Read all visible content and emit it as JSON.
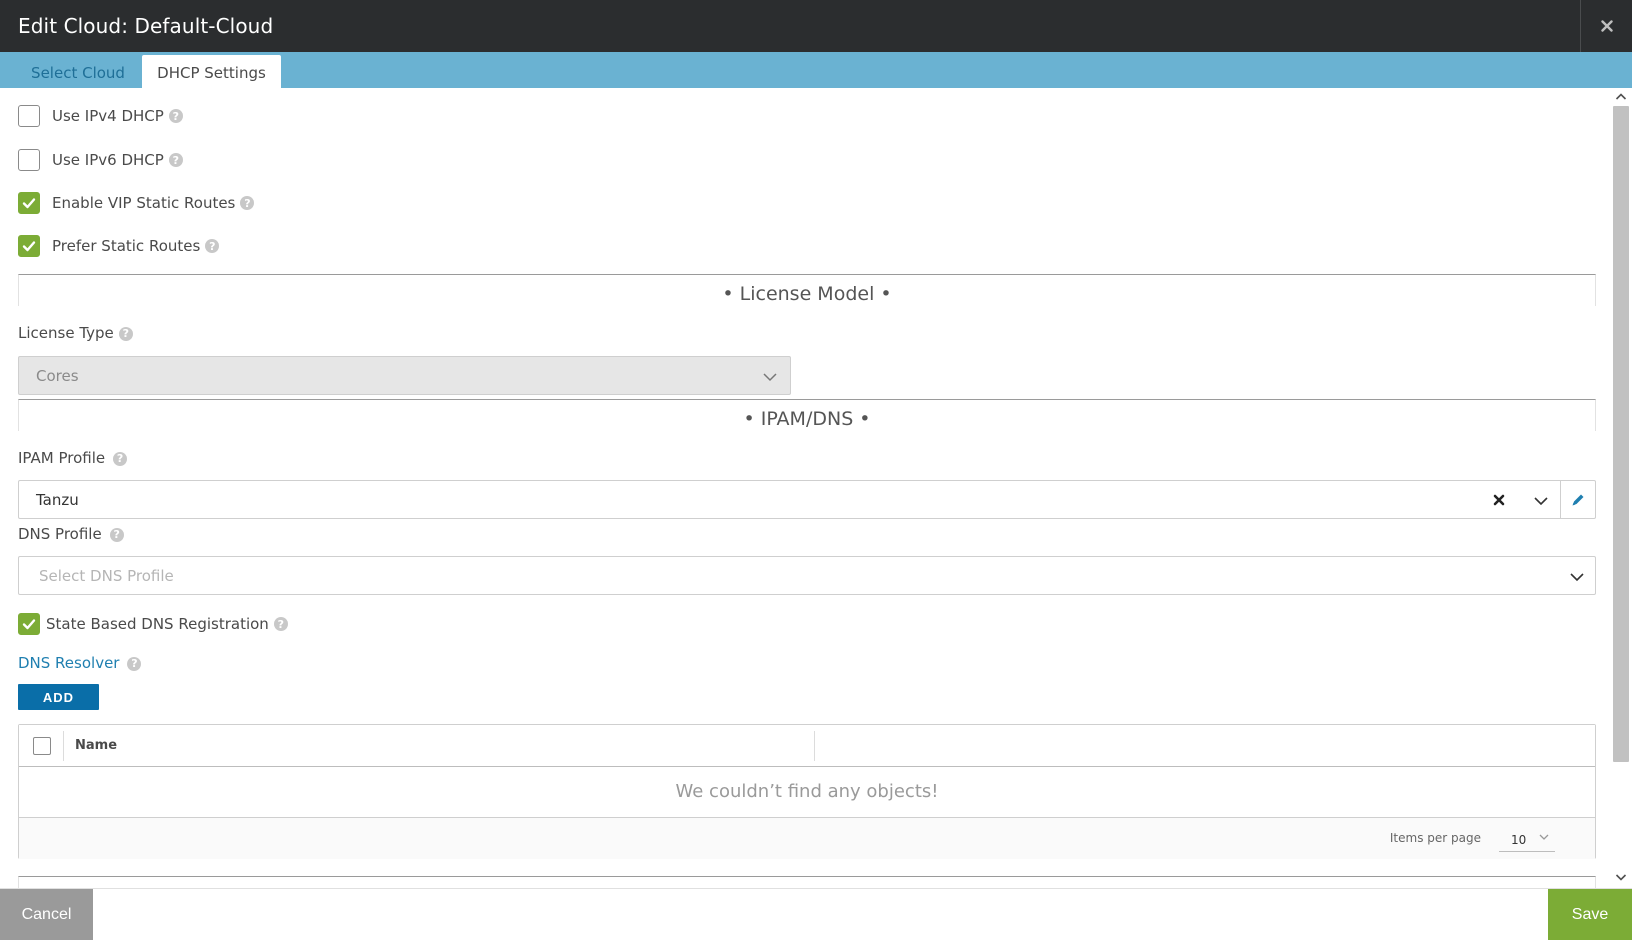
{
  "window": {
    "title": "Edit Cloud: Default-Cloud"
  },
  "tabs": [
    {
      "label": "Select Cloud",
      "active": false
    },
    {
      "label": "DHCP Settings",
      "active": true
    }
  ],
  "options": {
    "ipv4_dhcp": {
      "label": "Use IPv4 DHCP",
      "checked": false
    },
    "ipv6_dhcp": {
      "label": "Use IPv6 DHCP",
      "checked": false
    },
    "vip_static_routes": {
      "label": "Enable VIP Static Routes",
      "checked": true
    },
    "prefer_static_routes": {
      "label": "Prefer Static Routes",
      "checked": true
    }
  },
  "license_section": {
    "title": "• License Model •",
    "license_type_label": "License Type",
    "license_type_value": "Cores"
  },
  "ipam_section": {
    "title": "• IPAM/DNS •",
    "ipam_profile_label": "IPAM Profile",
    "ipam_profile_value": "Tanzu",
    "dns_profile_label": "DNS Profile",
    "dns_profile_placeholder": "Select DNS Profile",
    "state_dns_registration": {
      "label": "State Based DNS Registration",
      "checked": true
    },
    "dns_resolver_label": "DNS Resolver",
    "add_label": "ADD"
  },
  "resolver_grid": {
    "columns": [
      "Name"
    ],
    "empty_message": "We couldn’t find any objects!",
    "items_per_page_label": "Items per page",
    "items_per_page_value": "10"
  },
  "footer": {
    "cancel_label": "Cancel",
    "save_label": "Save"
  },
  "icons": {
    "help": "help-icon",
    "help_glyph": "?",
    "check": "checkmark-icon",
    "close": "close-icon",
    "chevron": "chevron-down-icon",
    "edit": "pencil-icon",
    "clear": "clear-icon"
  },
  "colors": {
    "titlebar": "#2b2d2f",
    "tabbar": "#6ab2d2",
    "accent_green": "#7cac36",
    "button_blue": "#0a6ea8",
    "link_blue": "#1f7fb0"
  }
}
